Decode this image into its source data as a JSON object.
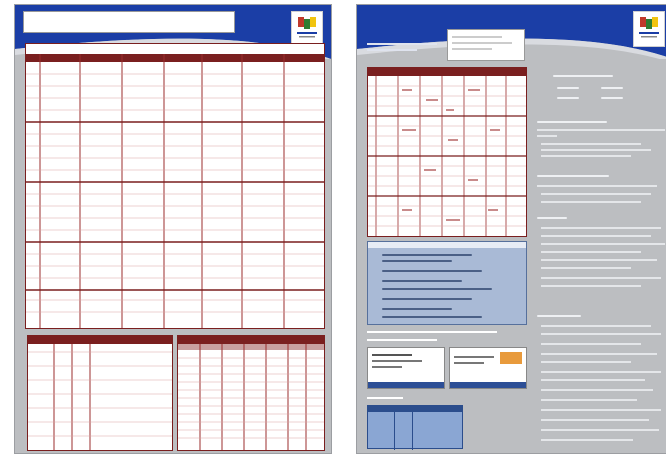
{
  "left_page": {
    "title_box_text": "",
    "schedule_title": "",
    "schedule_columns": [
      "",
      "",
      "",
      "",
      "",
      "",
      "",
      ""
    ],
    "bottom_left_title": "",
    "bottom_right_title": ""
  },
  "right_page": {
    "header_title": "",
    "info_box_text": "",
    "headings": [
      "",
      "",
      "",
      "",
      ""
    ],
    "section_label": "",
    "table_label": ""
  },
  "colors": {
    "banner_blue": "#1b3ea6",
    "panel_grey": "#bcbec1",
    "grid_red": "#9b2c2c",
    "light_blue": "#a9bad6"
  },
  "icons": {
    "logo": "flag-logo-icon"
  }
}
